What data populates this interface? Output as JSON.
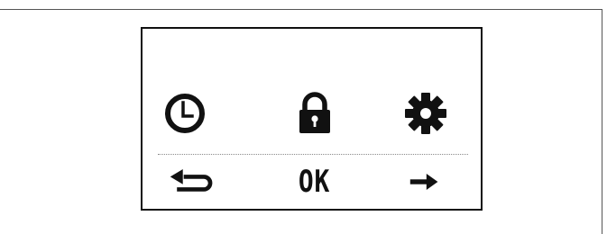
{
  "screen": {
    "icons": [
      {
        "name": "clock-icon"
      },
      {
        "name": "lock-icon"
      },
      {
        "name": "gear-icon"
      }
    ],
    "softkeys": {
      "back": {
        "icon": "return-arrow-icon"
      },
      "ok": {
        "label": "OK"
      },
      "next": {
        "icon": "right-arrow-icon"
      }
    }
  },
  "colors": {
    "foreground": "#111111",
    "background": "#ffffff",
    "divider": "#8a8a8a"
  }
}
